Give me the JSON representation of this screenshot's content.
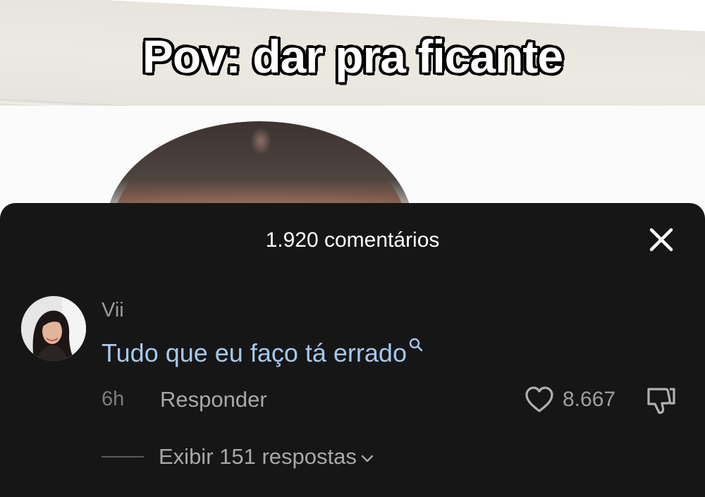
{
  "video": {
    "caption": "Pov: dar pra ficante"
  },
  "comments_sheet": {
    "title": "1.920 comentários",
    "close_icon": "close-icon"
  },
  "comment": {
    "username": "Vii",
    "text": "Tudo que eu faço tá errado",
    "time": "6h",
    "reply_label": "Responder",
    "like_count": "8.667",
    "view_replies_label": "Exibir 151 respostas",
    "icons": [
      "heart-icon",
      "thumbs-down-icon",
      "search-icon",
      "chevron-down-icon"
    ]
  },
  "colors": {
    "sheet_background": "#161616",
    "comment_text": "#a4c8ec",
    "caption_text": "#ffffff"
  }
}
